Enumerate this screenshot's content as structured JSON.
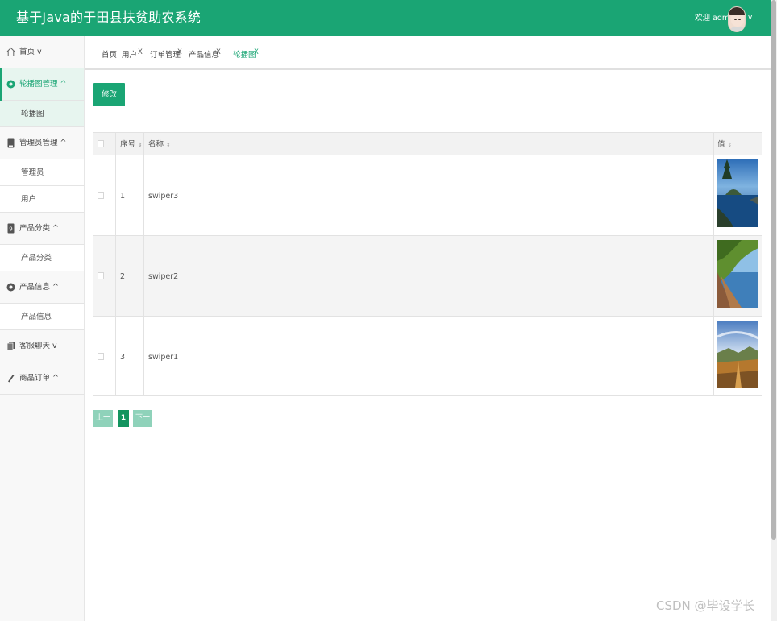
{
  "header": {
    "title": "基于Java的于田县扶贫助农系统",
    "welcome": "欢迎 admin",
    "caret": "v"
  },
  "sidebar": {
    "menus": [
      {
        "label": "首页",
        "arrow": "v",
        "icon": "home-icon",
        "subs": []
      },
      {
        "label": "轮播图管理",
        "arrow": "^",
        "icon": "carousel-icon",
        "active": true,
        "subs": [
          "轮播图"
        ]
      },
      {
        "label": "管理员管理",
        "arrow": "^",
        "icon": "admin-icon",
        "subs": [
          "管理员",
          "用户"
        ]
      },
      {
        "label": "产品分类",
        "arrow": "^",
        "icon": "category-icon",
        "subs": [
          "产品分类"
        ]
      },
      {
        "label": "产品信息",
        "arrow": "^",
        "icon": "product-icon",
        "subs": [
          "产品信息"
        ]
      },
      {
        "label": "客服聊天",
        "arrow": "v",
        "icon": "chat-icon",
        "subs": []
      },
      {
        "label": "商品订单",
        "arrow": "^",
        "icon": "order-icon",
        "subs": []
      }
    ]
  },
  "tabs": [
    {
      "label": "首页",
      "close": ""
    },
    {
      "label": "用户",
      "close": "X"
    },
    {
      "label": "订单管理",
      "close": "X"
    },
    {
      "label": "产品信息",
      "close": "X"
    },
    {
      "label": "轮播图",
      "close": "X",
      "active": true
    }
  ],
  "toolbar": {
    "edit_label": "修改"
  },
  "table": {
    "headers": {
      "index": "序号",
      "name": "名称",
      "value": "值",
      "sort_glyph": "⇕"
    },
    "rows": [
      {
        "index": "1",
        "name": "swiper3",
        "image": "lake-island-image"
      },
      {
        "index": "2",
        "name": "swiper2",
        "image": "lakeside-trees-image"
      },
      {
        "index": "3",
        "name": "swiper1",
        "image": "autumn-valley-image"
      }
    ]
  },
  "pager": {
    "prev": "上一页",
    "current": "1",
    "next": "下一页"
  },
  "watermark": "CSDN @毕设学长",
  "colors": {
    "accent": "#1aa574",
    "active_bg": "#e7f5ef"
  }
}
